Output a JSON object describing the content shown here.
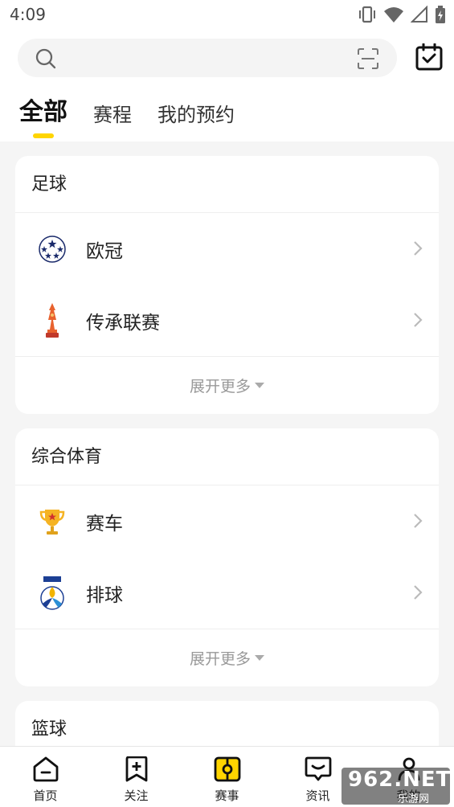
{
  "status_bar": {
    "time": "4:09"
  },
  "tabs": [
    {
      "label": "全部",
      "active": true
    },
    {
      "label": "赛程",
      "active": false
    },
    {
      "label": "我的预约",
      "active": false
    }
  ],
  "sections": [
    {
      "title": "足球",
      "items": [
        {
          "label": "欧冠",
          "icon": "champions-league-logo"
        },
        {
          "label": "传承联赛",
          "icon": "heritage-league-trophy-logo"
        }
      ],
      "expand_label": "展开更多"
    },
    {
      "title": "综合体育",
      "items": [
        {
          "label": "赛车",
          "icon": "trophy-logo"
        },
        {
          "label": "排球",
          "icon": "fivb-volleyball-logo"
        }
      ],
      "expand_label": "展开更多"
    },
    {
      "title": "篮球",
      "items": [],
      "expand_label": ""
    }
  ],
  "bottom_nav": [
    {
      "label": "首页",
      "icon": "home-icon"
    },
    {
      "label": "关注",
      "icon": "bookmark-add-icon"
    },
    {
      "label": "赛事",
      "icon": "match-icon",
      "active": true
    },
    {
      "label": "资讯",
      "icon": "news-chat-icon"
    },
    {
      "label": "我的",
      "icon": "profile-icon"
    }
  ],
  "watermark": {
    "big": "962.NET",
    "small": "乐游网"
  },
  "colors": {
    "accent": "#ffd500",
    "background": "#f5f5f5"
  }
}
